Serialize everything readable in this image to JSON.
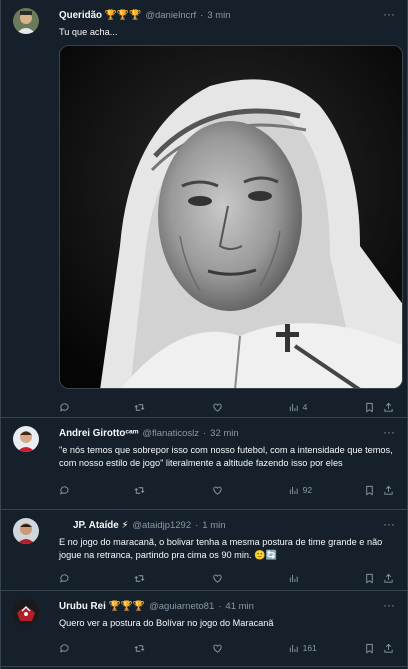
{
  "tweets": [
    {
      "name": "Queridão 🏆🏆🏆",
      "handle": "@danielncrf",
      "time": "3 min",
      "text": "Tu que acha...",
      "views": "4",
      "has_media": true
    },
    {
      "name": "Andrei Girottoᶜᵃᵐ",
      "handle": "@flanaticoslz",
      "time": "32 min",
      "text": "\"e nós temos que sobrepor isso com nosso futebol, com a intensidade que temos, com nosso estilo de jogo\" literalmente a altitude fazendo isso por eles",
      "views": "92"
    },
    {
      "name": "JP. Ataíde ⚡",
      "handle": "@ataidjp1292",
      "time": "1 min",
      "text": "E no jogo do maracanã, o bolivar tenha a mesma postura de time grande e não jogue na retranca, partindo pra cima os 90 min. 🙂🔄",
      "views": ""
    },
    {
      "name": "Urubu Rei 🏆🏆🏆",
      "handle": "@aguiarneto81",
      "time": "41 min",
      "text": "Quero ver a postura do Bolívar no jogo do Maracanã",
      "views": "161"
    }
  ],
  "colors": {
    "background": "#15202b",
    "border": "#38444d",
    "muted": "#8b98a5",
    "text": "#f7f9f9"
  },
  "icons": [
    "reply-icon",
    "retweet-icon",
    "like-icon",
    "views-icon",
    "bookmark-icon",
    "share-icon",
    "more-icon"
  ]
}
